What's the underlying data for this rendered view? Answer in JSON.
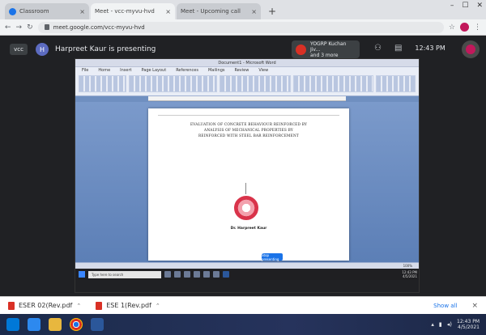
{
  "browser": {
    "tabs": [
      {
        "title": "Classroom",
        "active": false
      },
      {
        "title": "Meet - vcc-myvu-hvd",
        "active": true
      },
      {
        "title": "Meet - Upcoming call",
        "active": false
      }
    ],
    "new_tab": "+",
    "tab_close": "×",
    "url": "meet.google.com/vcc-myvu-hvd"
  },
  "meet": {
    "back_label": "vcc",
    "presenter_initial": "H",
    "presenting_text": "Harpreet Kaur is presenting",
    "participant_tile": {
      "name_line1": "YOGRP Kuchan Jiv...",
      "name_line2": "and 3 more"
    },
    "time": "12:43 PM"
  },
  "shared_screen": {
    "window_title": "Document1 - Microsoft Word",
    "ribbon_tabs": [
      "File",
      "Home",
      "Insert",
      "Page Layout",
      "References",
      "Mailings",
      "Review",
      "View"
    ],
    "document": {
      "lines": [
        "EVALUATION OF CONCRETE BEHAVIOUR REINFORCED BY",
        "ANALYSIS OF MECHANICAL PROPERTIES BY",
        "REINFORCED WITH STEEL BAR REINFORCEMENT"
      ],
      "caption": "Dr. Harpreet Kaur"
    },
    "status_right": "100%",
    "present_button": "Stop presenting",
    "search_placeholder": "Type here to search",
    "tray_time": "12:43 PM",
    "tray_date": "4/5/2021"
  },
  "downloads": {
    "items": [
      {
        "name": "ESER 02(Rev.pdf"
      },
      {
        "name": "ESE 1(Rev.pdf"
      }
    ],
    "show_all": "Show all",
    "close": "×"
  },
  "taskbar": {
    "time": "12:43 PM",
    "date": "4/5/2021"
  },
  "colors": {
    "meet_background": "#202124",
    "word_blue": "#2b579a",
    "seal_red": "#d9334a"
  }
}
